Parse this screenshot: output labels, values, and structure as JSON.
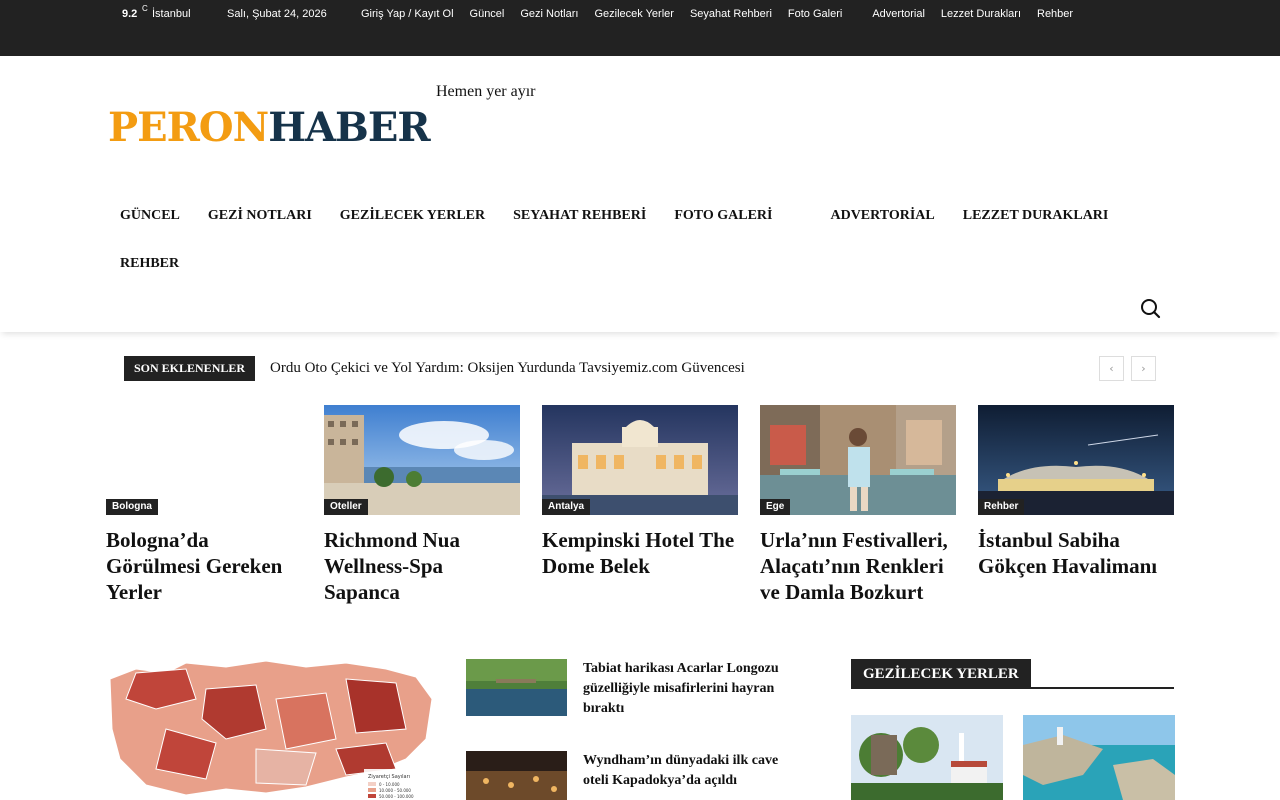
{
  "topbar": {
    "temperature": "9.2",
    "unit": "C",
    "city": "İstanbul",
    "date": "Salı, Şubat 24, 2026",
    "links": [
      "Giriş Yap / Kayıt Ol",
      "Güncel",
      "Gezi Notları",
      "Gezilecek Yerler",
      "Seyahat Rehberi",
      "Foto Galeri",
      "Advertorial",
      "Lezzet Durakları",
      "Rehber"
    ]
  },
  "header": {
    "logo_part1": "PERON",
    "logo_part2": "HABER",
    "tagline": "Hemen yer ayır"
  },
  "mainnav": [
    "GÜNCEL",
    "GEZİ NOTLARI",
    "GEZİLECEK YERLER",
    "SEYAHAT REHBERİ",
    "FOTO GALERİ",
    "ADVERTORİAL",
    "LEZZET DURAKLARI",
    "REHBER"
  ],
  "ticker": {
    "label": "SON EKLENENLER",
    "headline": "Ordu Oto Çekici ve Yol Yardım: Oksijen Yurdunda Tavsiyemiz.com Güvencesi",
    "prev_icon": "‹",
    "next_icon": "›"
  },
  "cards": [
    {
      "category": "Bologna",
      "title": "Bologna’da Görülmesi Gereken Yerler"
    },
    {
      "category": "Oteller",
      "title": "Richmond Nua Wellness-Spa Sapanca"
    },
    {
      "category": "Antalya",
      "title": "Kempinski Hotel The Dome Belek"
    },
    {
      "category": "Ege",
      "title": "Urla’nın Festivalleri, Alaçatı’nın Renkleri ve Damla Bozkurt"
    },
    {
      "category": "Rehber",
      "title": "İstanbul Sabiha Gökçen Havalimanı"
    }
  ],
  "side_articles": [
    {
      "title": "Tabiat harikası Acarlar Longozu güzelliğiyle misafirlerini hayran bıraktı"
    },
    {
      "title": "Wyndham’ın dünyadaki ilk cave oteli Kapadokya’da açıldı"
    }
  ],
  "map_legend": {
    "title": "Ziyaretçi Sayıları",
    "rows": [
      "0 - 10.000",
      "10.000 - 50.000",
      "50.000 - 100.000"
    ]
  },
  "widget": {
    "title": "GEZİLECEK YERLER"
  },
  "colors": {
    "topbar_bg": "#222222",
    "logo_orange": "#f39c12",
    "logo_navy": "#16334a"
  }
}
